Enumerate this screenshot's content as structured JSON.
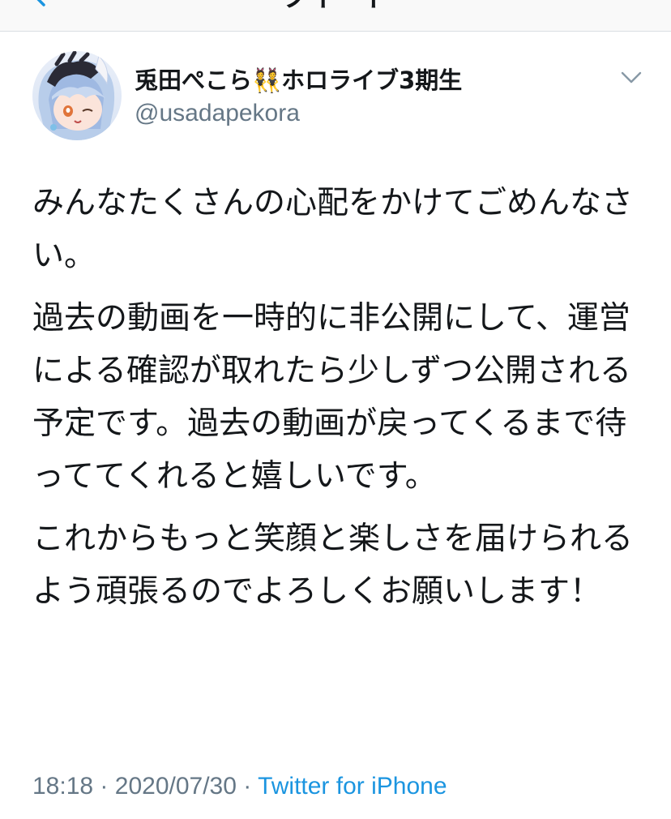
{
  "nav": {
    "title": "ツイート"
  },
  "tweet": {
    "display_name": "兎田ぺこら👯ホロライブ3期生",
    "handle": "@usadapekora",
    "paragraphs": [
      "みんなたくさんの心配をかけてごめんなさい。",
      "過去の動画を一時的に非公開にして、運営による確認が取れたら少しずつ公開される予定です。過去の動画が戻ってくるまで待っててくれると嬉しいです。",
      "これからもっと笑顔と楽しさを届けられるよう頑張るのでよろしくお願いします！"
    ],
    "time": "18:18",
    "separator": "·",
    "date": "2020/07/30",
    "source": "Twitter for iPhone"
  },
  "icons": {
    "back": "chevron-left-icon",
    "menu": "chevron-down-icon"
  },
  "colors": {
    "text": "#14171a",
    "secondary": "#657786",
    "link": "#1b95e0",
    "divider": "#d9dee2"
  }
}
